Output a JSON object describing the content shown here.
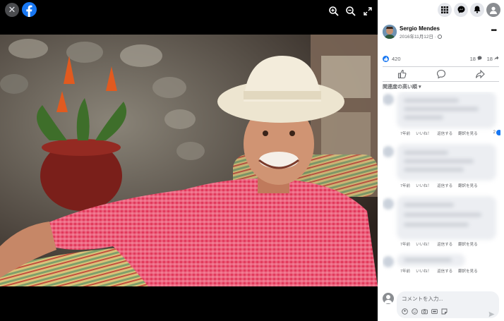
{
  "viewer": {
    "close_icon": "✕",
    "tools": [
      "zoom-in-icon",
      "zoom-out-icon",
      "fullscreen-icon"
    ]
  },
  "header": {
    "buttons": [
      "menu-grid-icon",
      "messenger-icon",
      "notifications-icon",
      "account-icon"
    ]
  },
  "post": {
    "author": "Sergio Mendes",
    "date": "2016年11月12日 ·",
    "reactions": "420",
    "comments": "18",
    "shares": "18",
    "sort_label": "関連度の高い順 ▾"
  },
  "comments": [
    {
      "time": "7年前",
      "like": "いいね！",
      "reply": "返信する",
      "translate": "翻訳を見る",
      "reactions": "2"
    },
    {
      "time": "7年前",
      "like": "いいね！",
      "reply": "返信する",
      "translate": "翻訳を見る"
    },
    {
      "time": "7年前",
      "like": "いいね！",
      "reply": "返信する",
      "translate": "翻訳を見る"
    },
    {
      "time": "7年前",
      "like": "いいね！",
      "reply": "返信する",
      "translate": "翻訳を見る"
    }
  ],
  "composer": {
    "placeholder": "コメントを入力..."
  },
  "colors": {
    "brand": "#1877f2",
    "panel_bg": "#ffffff",
    "viewer_bg": "#000000"
  }
}
